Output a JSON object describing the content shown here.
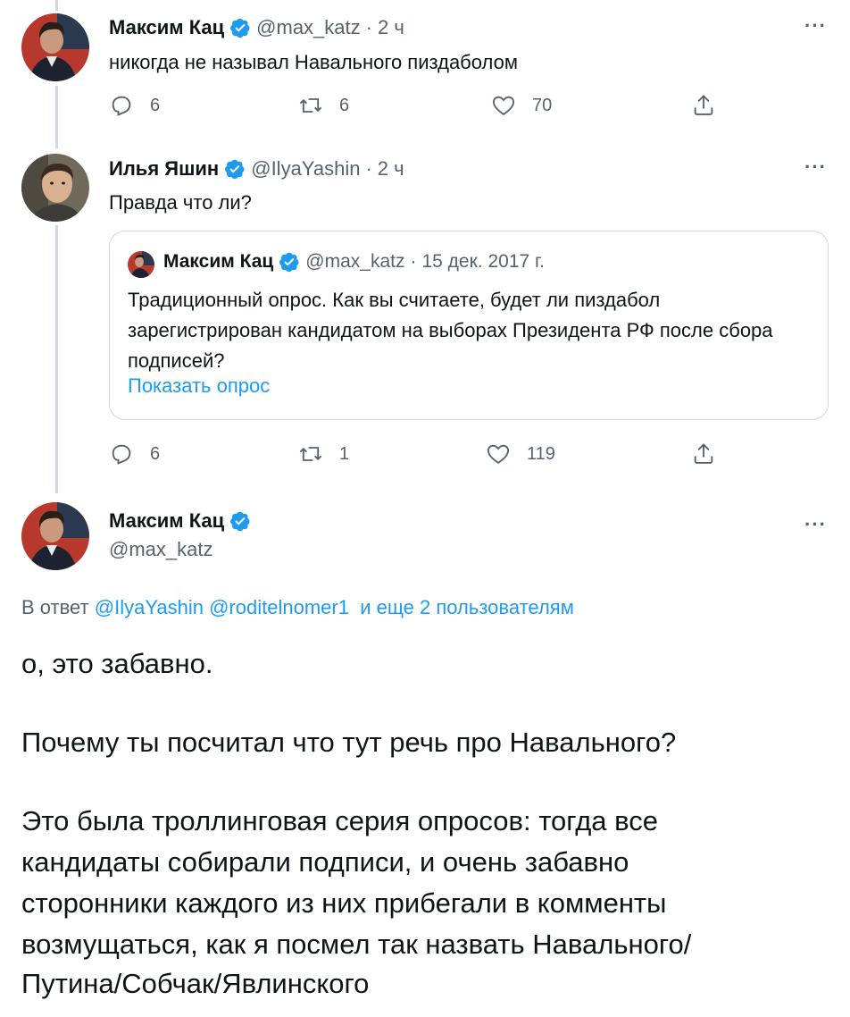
{
  "tweet1": {
    "author_name": "Максим Кац",
    "handle": "@max_katz",
    "separator": "·",
    "time": "2 ч",
    "text": "никогда не называл Навального пиздаболом",
    "more": "···",
    "replies": "6",
    "retweets": "6",
    "likes": "70"
  },
  "tweet2": {
    "author_name": "Илья Яшин",
    "handle": "@IlyaYashin",
    "separator": "·",
    "time": "2 ч",
    "text": "Правда что ли?",
    "more": "···",
    "replies": "6",
    "retweets": "1",
    "likes": "119",
    "quote": {
      "author_name": "Максим Кац",
      "handle": "@max_katz",
      "separator": "·",
      "date": "15 дек. 2017 г.",
      "text": "Традиционный опрос. Как вы считаете, будет ли пиздабол зарегистрирован кандидатом на выборах Президента РФ после сбора подписей?",
      "show_poll": "Показать опрос"
    }
  },
  "tweet3": {
    "author_name": "Максим Кац",
    "handle": "@max_katz",
    "more": "···",
    "reply_prefix": "В ответ",
    "reply_mention1": "@IlyaYashin",
    "reply_mention2": "@roditelnomer1",
    "reply_suffix": "и еще 2 пользователям",
    "line1": "о, это забавно.",
    "line2": "Почему ты посчитал что тут речь про Навального?",
    "line3": "Это была троллинговая серия опросов: тогда все",
    "line4": "кандидаты собирали подписи, и очень забавно",
    "line5": "сторонники каждого из них прибегали в комменты",
    "line6": "возмущаться, как я посмел так назвать Навального/",
    "line7": "Путина/Собчак/Явлинского"
  },
  "colors": {
    "accent": "#1d9bf0",
    "secondary_text": "#536471",
    "border": "#cfd9de"
  },
  "icons": [
    "verified-badge-icon",
    "more-icon",
    "reply-icon",
    "retweet-icon",
    "like-icon",
    "share-icon"
  ]
}
